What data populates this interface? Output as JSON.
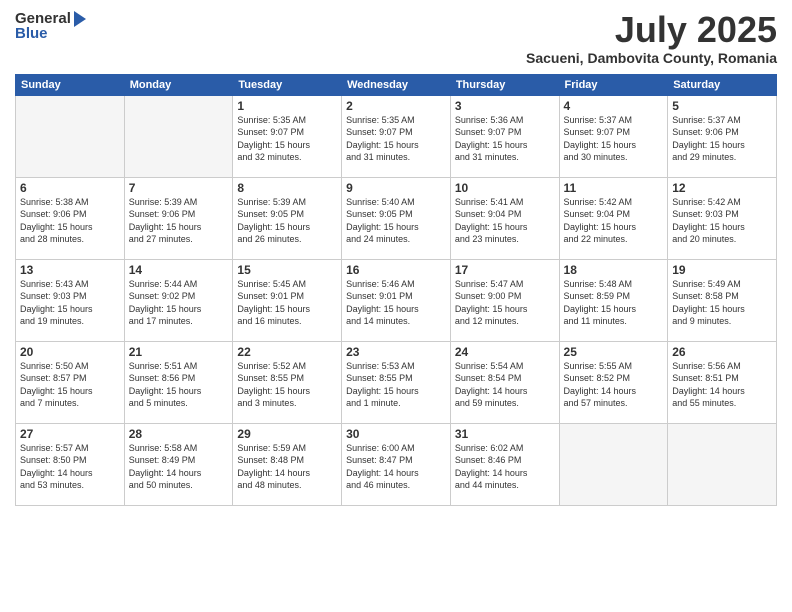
{
  "logo": {
    "general": "General",
    "blue": "Blue"
  },
  "title": {
    "month_year": "July 2025",
    "location": "Sacueni, Dambovita County, Romania"
  },
  "weekdays": [
    "Sunday",
    "Monday",
    "Tuesday",
    "Wednesday",
    "Thursday",
    "Friday",
    "Saturday"
  ],
  "weeks": [
    [
      {
        "day": "",
        "info": ""
      },
      {
        "day": "",
        "info": ""
      },
      {
        "day": "1",
        "info": "Sunrise: 5:35 AM\nSunset: 9:07 PM\nDaylight: 15 hours\nand 32 minutes."
      },
      {
        "day": "2",
        "info": "Sunrise: 5:35 AM\nSunset: 9:07 PM\nDaylight: 15 hours\nand 31 minutes."
      },
      {
        "day": "3",
        "info": "Sunrise: 5:36 AM\nSunset: 9:07 PM\nDaylight: 15 hours\nand 31 minutes."
      },
      {
        "day": "4",
        "info": "Sunrise: 5:37 AM\nSunset: 9:07 PM\nDaylight: 15 hours\nand 30 minutes."
      },
      {
        "day": "5",
        "info": "Sunrise: 5:37 AM\nSunset: 9:06 PM\nDaylight: 15 hours\nand 29 minutes."
      }
    ],
    [
      {
        "day": "6",
        "info": "Sunrise: 5:38 AM\nSunset: 9:06 PM\nDaylight: 15 hours\nand 28 minutes."
      },
      {
        "day": "7",
        "info": "Sunrise: 5:39 AM\nSunset: 9:06 PM\nDaylight: 15 hours\nand 27 minutes."
      },
      {
        "day": "8",
        "info": "Sunrise: 5:39 AM\nSunset: 9:05 PM\nDaylight: 15 hours\nand 26 minutes."
      },
      {
        "day": "9",
        "info": "Sunrise: 5:40 AM\nSunset: 9:05 PM\nDaylight: 15 hours\nand 24 minutes."
      },
      {
        "day": "10",
        "info": "Sunrise: 5:41 AM\nSunset: 9:04 PM\nDaylight: 15 hours\nand 23 minutes."
      },
      {
        "day": "11",
        "info": "Sunrise: 5:42 AM\nSunset: 9:04 PM\nDaylight: 15 hours\nand 22 minutes."
      },
      {
        "day": "12",
        "info": "Sunrise: 5:42 AM\nSunset: 9:03 PM\nDaylight: 15 hours\nand 20 minutes."
      }
    ],
    [
      {
        "day": "13",
        "info": "Sunrise: 5:43 AM\nSunset: 9:03 PM\nDaylight: 15 hours\nand 19 minutes."
      },
      {
        "day": "14",
        "info": "Sunrise: 5:44 AM\nSunset: 9:02 PM\nDaylight: 15 hours\nand 17 minutes."
      },
      {
        "day": "15",
        "info": "Sunrise: 5:45 AM\nSunset: 9:01 PM\nDaylight: 15 hours\nand 16 minutes."
      },
      {
        "day": "16",
        "info": "Sunrise: 5:46 AM\nSunset: 9:01 PM\nDaylight: 15 hours\nand 14 minutes."
      },
      {
        "day": "17",
        "info": "Sunrise: 5:47 AM\nSunset: 9:00 PM\nDaylight: 15 hours\nand 12 minutes."
      },
      {
        "day": "18",
        "info": "Sunrise: 5:48 AM\nSunset: 8:59 PM\nDaylight: 15 hours\nand 11 minutes."
      },
      {
        "day": "19",
        "info": "Sunrise: 5:49 AM\nSunset: 8:58 PM\nDaylight: 15 hours\nand 9 minutes."
      }
    ],
    [
      {
        "day": "20",
        "info": "Sunrise: 5:50 AM\nSunset: 8:57 PM\nDaylight: 15 hours\nand 7 minutes."
      },
      {
        "day": "21",
        "info": "Sunrise: 5:51 AM\nSunset: 8:56 PM\nDaylight: 15 hours\nand 5 minutes."
      },
      {
        "day": "22",
        "info": "Sunrise: 5:52 AM\nSunset: 8:55 PM\nDaylight: 15 hours\nand 3 minutes."
      },
      {
        "day": "23",
        "info": "Sunrise: 5:53 AM\nSunset: 8:55 PM\nDaylight: 15 hours\nand 1 minute."
      },
      {
        "day": "24",
        "info": "Sunrise: 5:54 AM\nSunset: 8:54 PM\nDaylight: 14 hours\nand 59 minutes."
      },
      {
        "day": "25",
        "info": "Sunrise: 5:55 AM\nSunset: 8:52 PM\nDaylight: 14 hours\nand 57 minutes."
      },
      {
        "day": "26",
        "info": "Sunrise: 5:56 AM\nSunset: 8:51 PM\nDaylight: 14 hours\nand 55 minutes."
      }
    ],
    [
      {
        "day": "27",
        "info": "Sunrise: 5:57 AM\nSunset: 8:50 PM\nDaylight: 14 hours\nand 53 minutes."
      },
      {
        "day": "28",
        "info": "Sunrise: 5:58 AM\nSunset: 8:49 PM\nDaylight: 14 hours\nand 50 minutes."
      },
      {
        "day": "29",
        "info": "Sunrise: 5:59 AM\nSunset: 8:48 PM\nDaylight: 14 hours\nand 48 minutes."
      },
      {
        "day": "30",
        "info": "Sunrise: 6:00 AM\nSunset: 8:47 PM\nDaylight: 14 hours\nand 46 minutes."
      },
      {
        "day": "31",
        "info": "Sunrise: 6:02 AM\nSunset: 8:46 PM\nDaylight: 14 hours\nand 44 minutes."
      },
      {
        "day": "",
        "info": ""
      },
      {
        "day": "",
        "info": ""
      }
    ]
  ]
}
